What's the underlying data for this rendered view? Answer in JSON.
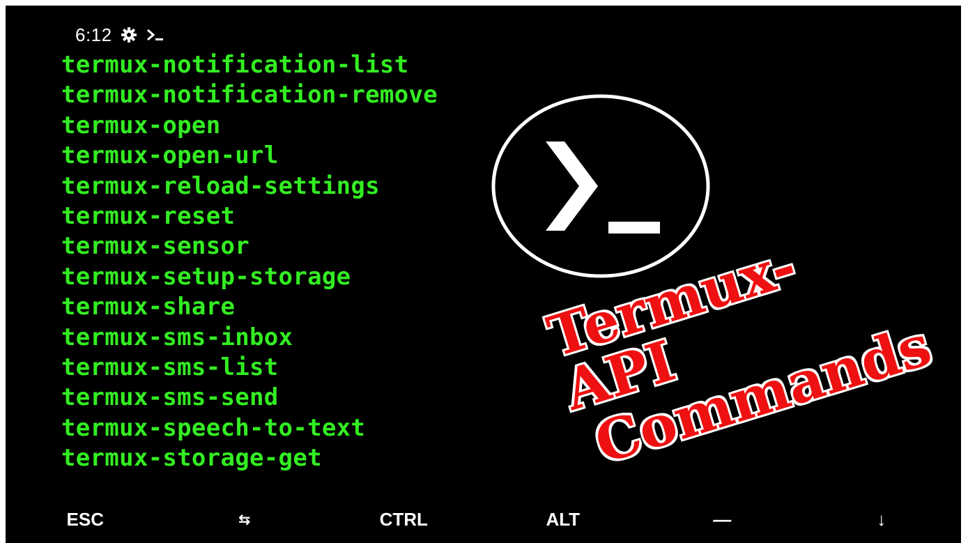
{
  "status_bar": {
    "time": "6:12",
    "icons": [
      "gear-icon",
      "terminal-prompt-icon"
    ]
  },
  "commands": [
    "termux-notification-list",
    "termux-notification-remove",
    "termux-open",
    "termux-open-url",
    "termux-reload-settings",
    "termux-reset",
    "termux-sensor",
    "termux-setup-storage",
    "termux-share",
    "termux-sms-inbox",
    "termux-sms-list",
    "termux-sms-send",
    "termux-speech-to-text",
    "termux-storage-get"
  ],
  "overlay": {
    "line1": "Termux-API",
    "line2": "Commands"
  },
  "extra_keys": {
    "esc": "ESC",
    "tab": "⇆",
    "ctrl": "CTRL",
    "alt": "ALT",
    "dash": "—",
    "down": "↓"
  },
  "colors": {
    "command_text": "#33ee22",
    "overlay_text": "#ee1111",
    "background": "#000000"
  }
}
